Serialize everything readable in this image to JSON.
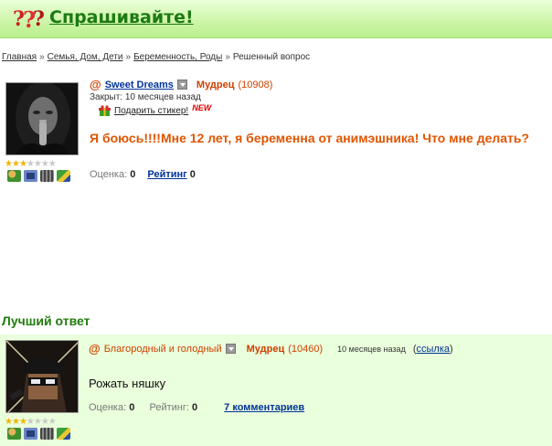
{
  "header": {
    "title": "Спрашивайте!",
    "logo_icon": "question-marks-icon"
  },
  "breadcrumbs": [
    {
      "label": "Главная",
      "link": true
    },
    {
      "label": "Семья, Дом, Дети",
      "link": true
    },
    {
      "label": "Беременность, Роды",
      "link": true
    },
    {
      "label": "Решенный вопрос",
      "link": false
    }
  ],
  "breadcrumb_separator": "»",
  "question": {
    "at_symbol": "@",
    "author": "Sweet Dreams",
    "rank": "Мудрец",
    "points": "(10908)",
    "closed": "Закрыт: 10 месяцев назад",
    "gift_label": "Подарить стикер!",
    "gift_badge": "NEW",
    "title": "Я боюсь!!!!Мне 12 лет, я беременна от анимэшника! Что мне делать?",
    "score_label": "Оценка:",
    "score_value": "0",
    "rating_label": "Рейтинг",
    "rating_value": "0",
    "stars_filled": 3,
    "stars_total": 7
  },
  "best_answer": {
    "heading": "Лучший ответ",
    "at_symbol": "@",
    "author": "Благородный и голодный",
    "rank": "Мудрец",
    "points": "(10460)",
    "time": "10 месяцев назад",
    "link_label": "ссылка",
    "text": "Рожать няшку",
    "score_label": "Оценка:",
    "score_value": "0",
    "rating_label": "Рейтинг:",
    "rating_value": "0",
    "comments_label": "7 комментариев",
    "stars_filled": 3,
    "stars_total": 7
  },
  "colors": {
    "header_green": "#cdf5a8",
    "title_green": "#1c7a12",
    "question_orange": "#e05500",
    "link_blue": "#003399",
    "answer_bg": "#eaffdc"
  }
}
